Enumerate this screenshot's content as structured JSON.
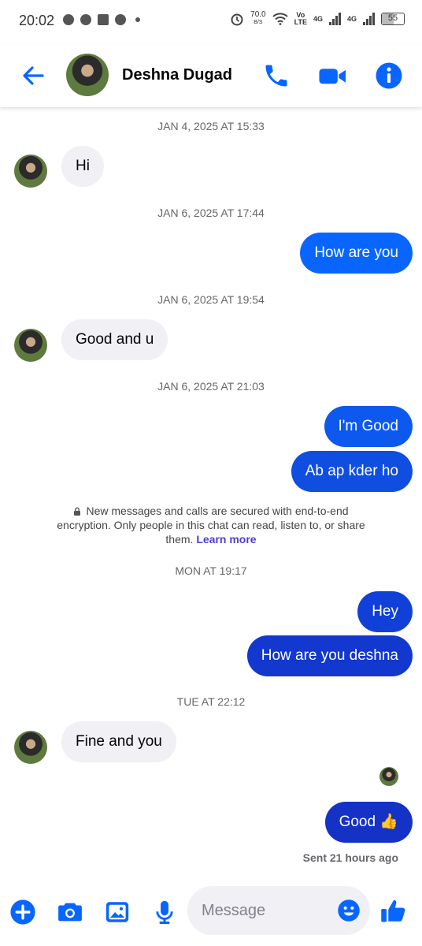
{
  "status_bar": {
    "time": "20:02",
    "net_speed": "70.0",
    "net_unit": "B/S",
    "volte_top": "Vo",
    "volte_bottom": "LTE",
    "sim1": "4G",
    "sim2": "4G",
    "battery": "55"
  },
  "header": {
    "contact_name": "Deshna Dugad",
    "accent_color": "#0866ff"
  },
  "messages": [
    {
      "type": "timestamp",
      "text": "JAN 4, 2025 AT 15:33"
    },
    {
      "type": "incoming",
      "text": "Hi"
    },
    {
      "type": "timestamp",
      "text": "JAN 6, 2025 AT 17:44"
    },
    {
      "type": "outgoing",
      "text": "How are you",
      "color": "#0866ff"
    },
    {
      "type": "timestamp",
      "text": "JAN 6, 2025 AT 19:54"
    },
    {
      "type": "incoming",
      "text": "Good and u"
    },
    {
      "type": "timestamp",
      "text": "JAN 6, 2025 AT 21:03"
    },
    {
      "type": "outgoing",
      "text": "I'm Good",
      "color": "#0d59f0"
    },
    {
      "type": "outgoing",
      "text": "Ab ap kder ho",
      "color": "#0f4ee0"
    },
    {
      "type": "encryption",
      "text": "New messages and calls are secured with end-to-end encryption. Only people in this chat can read, listen to, or share them.",
      "link": "Learn more"
    },
    {
      "type": "timestamp",
      "text": "MON AT 19:17"
    },
    {
      "type": "outgoing",
      "text": "Hey",
      "color": "#1140d8"
    },
    {
      "type": "outgoing",
      "text": "How are you deshna",
      "color": "#1238cf"
    },
    {
      "type": "timestamp",
      "text": "TUE AT 22:12"
    },
    {
      "type": "incoming",
      "text": "Fine and you"
    },
    {
      "type": "outgoing",
      "text": "Good 👍",
      "color": "#1432c6"
    }
  ],
  "sent_status": "Sent 21 hours ago",
  "composer": {
    "placeholder": "Message"
  }
}
